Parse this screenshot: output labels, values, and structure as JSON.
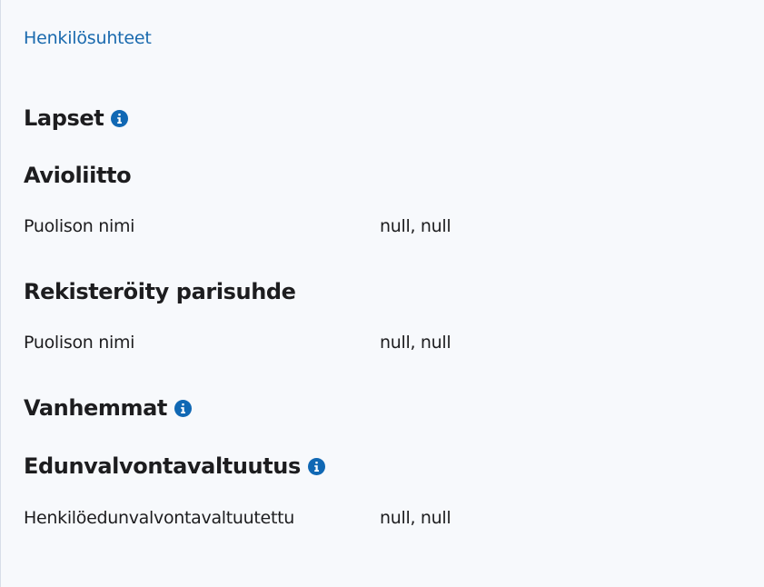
{
  "header": {
    "link_text": "Henkilösuhteet"
  },
  "sections": {
    "children": {
      "title": "Lapset",
      "icon": "info-icon"
    },
    "marriage": {
      "title": "Avioliitto",
      "rows": [
        {
          "label": "Puolison nimi",
          "value": "null, null"
        }
      ]
    },
    "partnership": {
      "title": "Rekisteröity parisuhde",
      "rows": [
        {
          "label": "Puolison nimi",
          "value": "null, null"
        }
      ]
    },
    "parents": {
      "title": "Vanhemmat",
      "icon": "info-icon"
    },
    "guardianship": {
      "title": "Edunvalvontavaltuutus",
      "icon": "info-icon",
      "rows": [
        {
          "label": "Henkilöedunvalvontavaltuutettu",
          "value": "null, null"
        }
      ]
    }
  },
  "colors": {
    "link": "#1a6aae",
    "info_icon": "#1068b4",
    "background": "#f7f9fc",
    "text": "#1d1d1f"
  }
}
